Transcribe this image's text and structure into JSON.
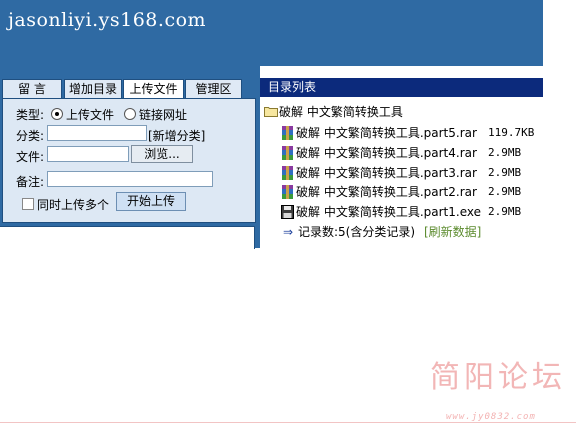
{
  "header": {
    "site_title": "jasonliyi.ys168.com"
  },
  "tabs": [
    {
      "label": "留 言"
    },
    {
      "label": "增加目录"
    },
    {
      "label": "上传文件",
      "active": true
    },
    {
      "label": "管理区"
    }
  ],
  "upload_form": {
    "type_label": "类型:",
    "type_options": [
      {
        "label": "上传文件",
        "selected": true
      },
      {
        "label": "链接网址",
        "selected": false
      }
    ],
    "category_label": "分类:",
    "category_value": "",
    "new_category_link": "[新增分类]",
    "file_label": "文件:",
    "file_value": "",
    "browse_label": "浏览...",
    "note_label": "备注:",
    "note_value": "",
    "multi_label": "同时上传多个",
    "multi_checked": false,
    "start_label": "开始上传"
  },
  "directory": {
    "header": "目录列表",
    "folder": "破解 中文繁简转换工具",
    "files": [
      {
        "name": "破解 中文繁简转换工具.part5.rar",
        "size": "119.7KB",
        "icon": "rar-archive-icon"
      },
      {
        "name": "破解 中文繁简转换工具.part4.rar",
        "size": "2.9MB",
        "icon": "rar-archive-icon"
      },
      {
        "name": "破解 中文繁简转换工具.part3.rar",
        "size": "2.9MB",
        "icon": "rar-archive-icon"
      },
      {
        "name": "破解 中文繁简转换工具.part2.rar",
        "size": "2.9MB",
        "icon": "rar-archive-icon"
      },
      {
        "name": "破解 中文繁简转换工具.part1.exe",
        "size": "2.9MB",
        "icon": "floppy-exe-icon"
      }
    ],
    "record_count": "记录数:5(含分类记录)",
    "refresh": "[刷新数据]"
  },
  "watermark": {
    "text": "简阳论坛",
    "url": "www.jy0832.com"
  },
  "colors": {
    "banner": "#2f6aa3",
    "dir_header": "#0c2a7c",
    "panel": "#dde8f4"
  }
}
